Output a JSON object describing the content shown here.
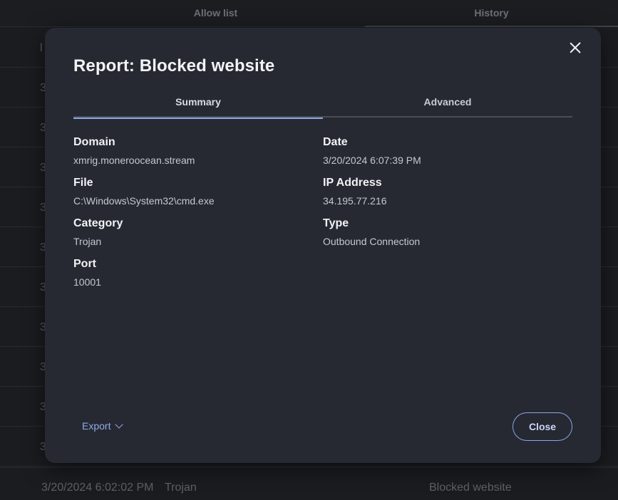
{
  "background": {
    "tabs": [
      "Allow list",
      "History"
    ],
    "row_leads": [
      "l",
      "3",
      "3",
      "3",
      "3",
      "3",
      "3",
      "3",
      "3",
      "3",
      "3"
    ],
    "last_row": {
      "date": "3/20/2024 6:02:02 PM",
      "category": "Trojan",
      "event": "Blocked website"
    }
  },
  "modal": {
    "title": "Report: Blocked website",
    "tabs": [
      "Summary",
      "Advanced"
    ],
    "active_tab": "Summary",
    "fields": {
      "domain": {
        "label": "Domain",
        "value": "xmrig.moneroocean.stream"
      },
      "date": {
        "label": "Date",
        "value": "3/20/2024 6:07:39 PM"
      },
      "file": {
        "label": "File",
        "value": "C:\\Windows\\System32\\cmd.exe"
      },
      "ip": {
        "label": "IP Address",
        "value": "34.195.77.216"
      },
      "category": {
        "label": "Category",
        "value": "Trojan"
      },
      "type": {
        "label": "Type",
        "value": "Outbound Connection"
      },
      "port": {
        "label": "Port",
        "value": "10001"
      }
    },
    "export_label": "Export",
    "close_label": "Close",
    "icons": {
      "close": "close-icon",
      "export_menu": "chevron-down-icon"
    },
    "colors": {
      "accent": "#8aa7e6",
      "modal_bg": "#262932",
      "page_bg": "#1b1c20"
    }
  }
}
